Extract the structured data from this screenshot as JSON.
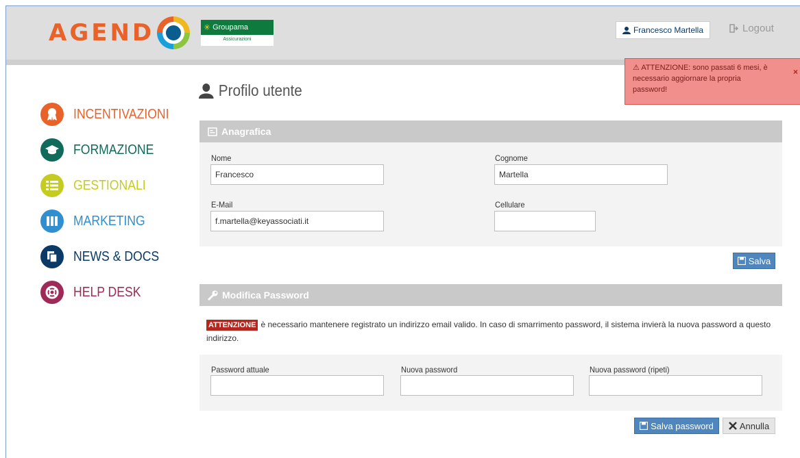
{
  "header": {
    "logo_text": "AGEND",
    "sponsor_name": "Groupama",
    "sponsor_sub": "Assicurazioni",
    "user_name": "Francesco Martella",
    "logout_label": "Logout"
  },
  "alert": {
    "message": "ATTENZIONE: sono passati 6 mesi, è necessario aggiornare la propria password!",
    "close": "×"
  },
  "nav": {
    "items": [
      {
        "label": "INCENTIVAZIONI",
        "color": "#e8622a",
        "icon": "award-icon"
      },
      {
        "label": "FORMAZIONE",
        "color": "#116a5a",
        "icon": "graduation-cap-icon"
      },
      {
        "label": "GESTIONALI",
        "color": "#c4cc22",
        "icon": "list-icon"
      },
      {
        "label": "MARKETING",
        "color": "#2f8fcf",
        "icon": "columns-icon"
      },
      {
        "label": "NEWS & DOCS",
        "color": "#0b3a66",
        "icon": "copy-icon"
      },
      {
        "label": "HELP DESK",
        "color": "#9e2a57",
        "icon": "life-ring-icon"
      }
    ]
  },
  "page": {
    "title": "Profilo utente"
  },
  "anagrafica": {
    "heading": "Anagrafica",
    "nome_label": "Nome",
    "nome_value": "Francesco",
    "cognome_label": "Cognome",
    "cognome_value": "Martella",
    "email_label": "E-Mail",
    "email_value": "f.martella@keyassociati.it",
    "cellulare_label": "Cellulare",
    "cellulare_value": "",
    "save_label": "Salva"
  },
  "password": {
    "heading": "Modifica Password",
    "notice_badge": "ATTENZIONE",
    "notice_text": "è necessario mantenere registrato un indirizzo email valido. In caso di smarrimento password, il sistema invierà la nuova password a questo indirizzo.",
    "current_label": "Password attuale",
    "new_label": "Nuova password",
    "repeat_label": "Nuova password (ripeti)",
    "save_label": "Salva password",
    "cancel_label": "Annulla"
  }
}
